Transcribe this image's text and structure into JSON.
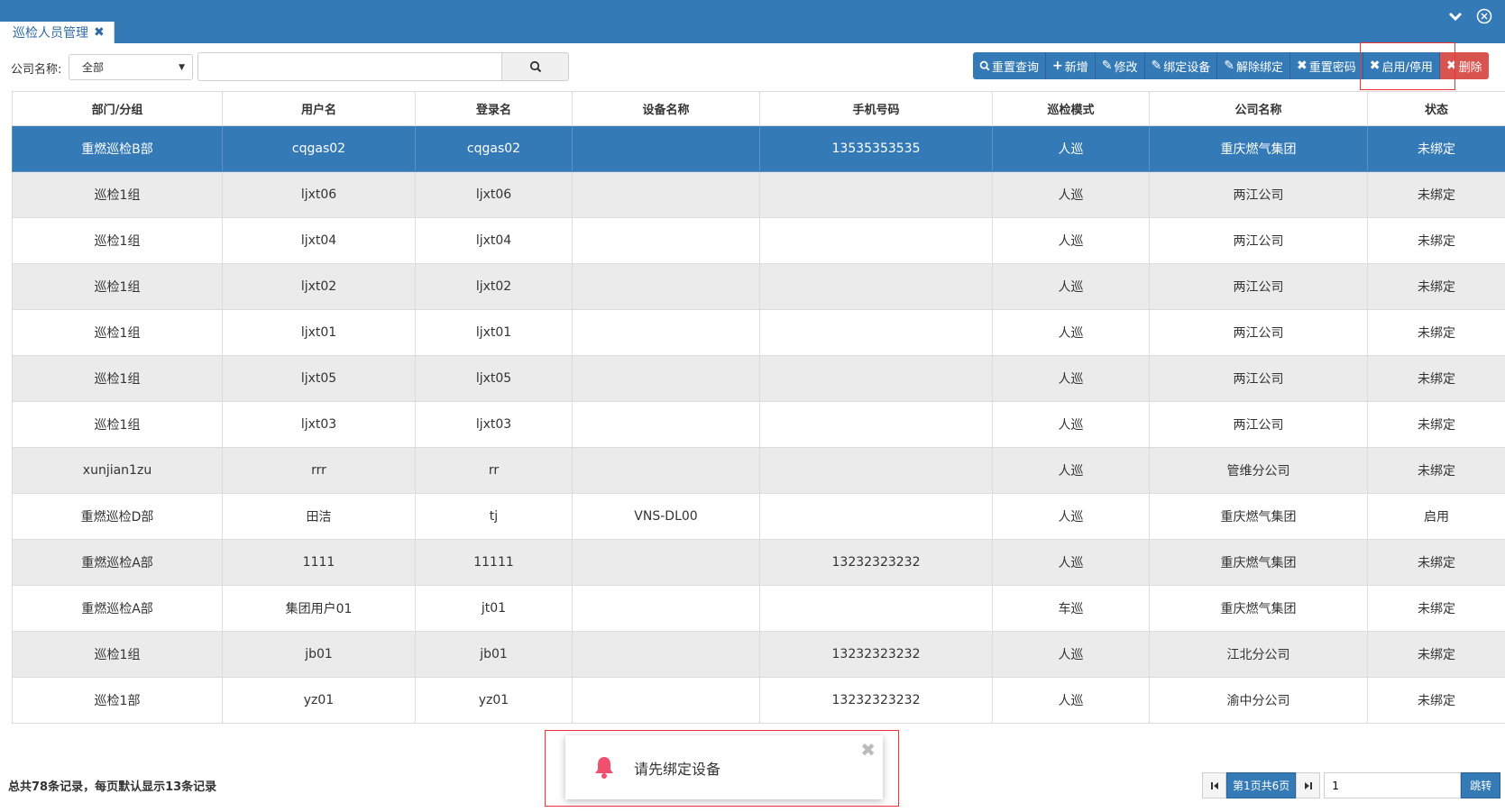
{
  "window": {
    "tab_label": "巡检人员管理",
    "tab_close_icon": "close-icon",
    "collapse_icon": "chevron-down-icon",
    "close_icon": "circle-close-icon"
  },
  "filter": {
    "company_label": "公司名称:",
    "company_selected": "全部",
    "search_value": "",
    "search_icon": "search-icon"
  },
  "toolbar": {
    "buttons": [
      {
        "icon": "search-icon",
        "glyph": "🔍",
        "label": "重置查询"
      },
      {
        "icon": "plus-icon",
        "glyph": "+",
        "label": "新增"
      },
      {
        "icon": "pencil-icon",
        "glyph": "✎",
        "label": "修改"
      },
      {
        "icon": "pencil-icon",
        "glyph": "✎",
        "label": "绑定设备"
      },
      {
        "icon": "pencil-icon",
        "glyph": "✎",
        "label": "解除绑定"
      },
      {
        "icon": "close-icon",
        "glyph": "✖",
        "label": "重置密码"
      },
      {
        "icon": "close-icon",
        "glyph": "✖",
        "label": "启用/停用"
      },
      {
        "icon": "close-icon",
        "glyph": "✖",
        "label": "删除"
      }
    ],
    "colors": {
      "primary": "#347ab7",
      "danger": "#d9534f"
    }
  },
  "table": {
    "columns": [
      "部门/分组",
      "用户名",
      "登录名",
      "设备名称",
      "手机号码",
      "巡检模式",
      "公司名称",
      "状态"
    ],
    "rows": [
      [
        "重燃巡检B部",
        "cqgas02",
        "cqgas02",
        "",
        "13535353535",
        "人巡",
        "重庆燃气集团",
        "未绑定"
      ],
      [
        "巡检1组",
        "ljxt06",
        "ljxt06",
        "",
        "",
        "人巡",
        "两江公司",
        "未绑定"
      ],
      [
        "巡检1组",
        "ljxt04",
        "ljxt04",
        "",
        "",
        "人巡",
        "两江公司",
        "未绑定"
      ],
      [
        "巡检1组",
        "ljxt02",
        "ljxt02",
        "",
        "",
        "人巡",
        "两江公司",
        "未绑定"
      ],
      [
        "巡检1组",
        "ljxt01",
        "ljxt01",
        "",
        "",
        "人巡",
        "两江公司",
        "未绑定"
      ],
      [
        "巡检1组",
        "ljxt05",
        "ljxt05",
        "",
        "",
        "人巡",
        "两江公司",
        "未绑定"
      ],
      [
        "巡检1组",
        "ljxt03",
        "ljxt03",
        "",
        "",
        "人巡",
        "两江公司",
        "未绑定"
      ],
      [
        "xunjian1zu",
        "rrr",
        "rr",
        "",
        "",
        "人巡",
        "管维分公司",
        "未绑定"
      ],
      [
        "重燃巡检D部",
        "田洁",
        "tj",
        "VNS-DL00",
        "",
        "人巡",
        "重庆燃气集团",
        "启用"
      ],
      [
        "重燃巡检A部",
        "1111",
        "11111",
        "",
        "13232323232",
        "人巡",
        "重庆燃气集团",
        "未绑定"
      ],
      [
        "重燃巡检A部",
        "集团用户01",
        "jt01",
        "",
        "",
        "车巡",
        "重庆燃气集团",
        "未绑定"
      ],
      [
        "巡检1组",
        "jb01",
        "jb01",
        "",
        "13232323232",
        "人巡",
        "江北分公司",
        "未绑定"
      ],
      [
        "巡检1部",
        "yz01",
        "yz01",
        "",
        "13232323232",
        "人巡",
        "渝中分公司",
        "未绑定"
      ]
    ],
    "selected_row": 0
  },
  "footer": {
    "total_text": "总共78条记录，每页默认显示13条记录",
    "page_info": "第1页共6页",
    "page_input_value": "1",
    "go_label": "跳转",
    "first_icon": "first-page-icon",
    "last_icon": "last-page-icon"
  },
  "toast": {
    "message": "请先绑定设备",
    "icon": "bell-icon",
    "bell_color": "#f0506e"
  }
}
